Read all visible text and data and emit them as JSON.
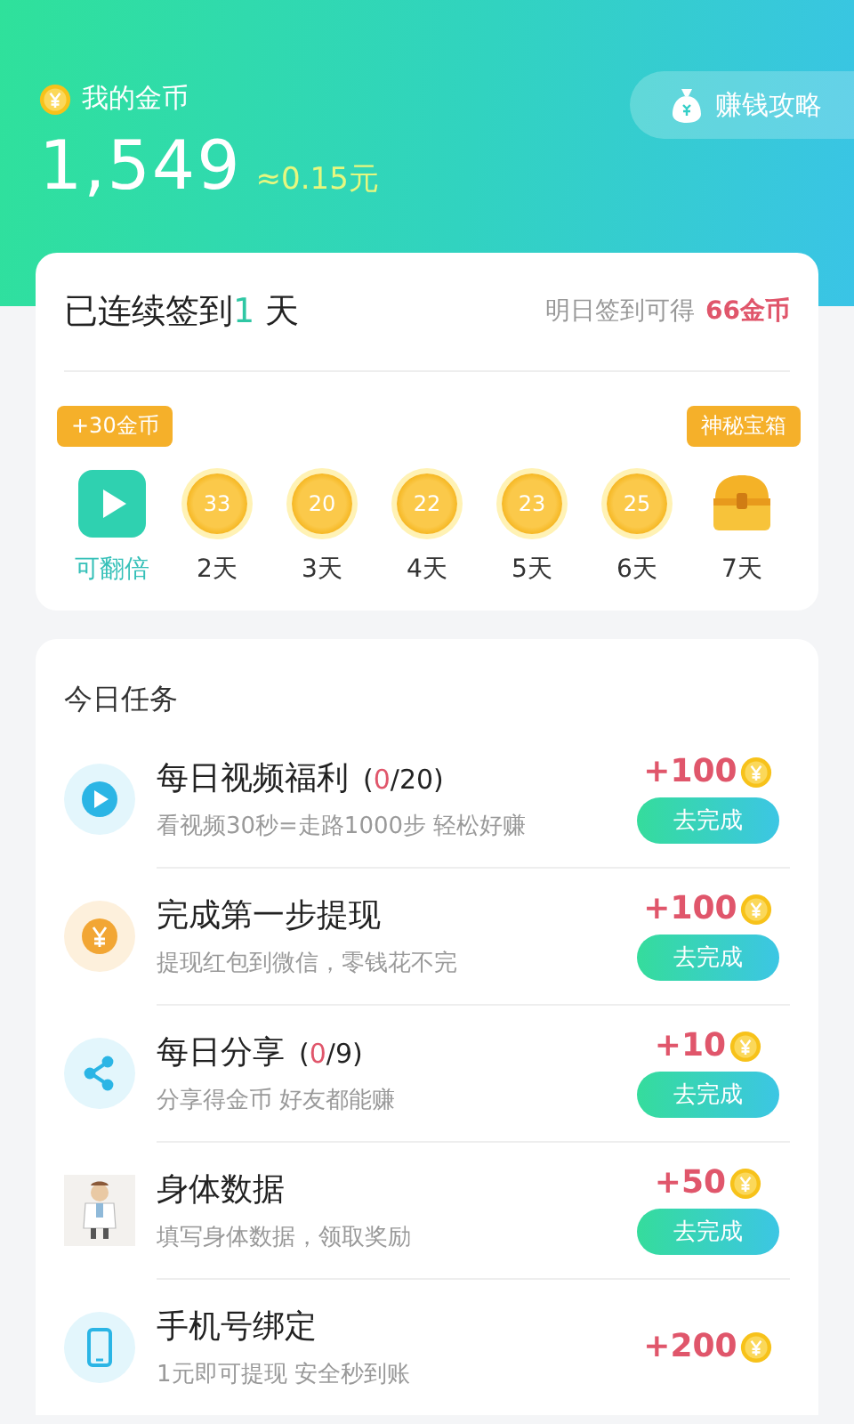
{
  "wallet": {
    "label": "我的金币",
    "balance": "1,549",
    "equivalent": "≈0.15元",
    "guide_button": "赚钱攻略"
  },
  "signin": {
    "streak_prefix": "已连续签到",
    "streak_days": "1",
    "streak_suffix": " 天",
    "tomorrow_label": "明日签到可得",
    "tomorrow_reward": "66金币",
    "days": [
      {
        "kind": "video",
        "label": "可翻倍",
        "tip": "+30金币",
        "highlight": true
      },
      {
        "kind": "coin",
        "amount": "33",
        "label": "2天",
        "highlight": false
      },
      {
        "kind": "coin",
        "amount": "20",
        "label": "3天",
        "highlight": false
      },
      {
        "kind": "coin",
        "amount": "22",
        "label": "4天",
        "highlight": false
      },
      {
        "kind": "coin",
        "amount": "23",
        "label": "5天",
        "highlight": false
      },
      {
        "kind": "coin",
        "amount": "25",
        "label": "6天",
        "highlight": false
      },
      {
        "kind": "chest",
        "label": "7天",
        "tip": "神秘宝箱",
        "highlight": false
      }
    ]
  },
  "tasks": {
    "title": "今日任务",
    "items": [
      {
        "kind": "play",
        "title": "每日视频福利",
        "progress": [
          {
            "kind": "plain",
            "text": "("
          },
          {
            "kind": "done",
            "text": "0"
          },
          {
            "kind": "plain",
            "text": "/20)"
          }
        ],
        "subtitle": "看视频30秒=走路1000步 轻松好赚",
        "reward": "+100",
        "button": "去完成"
      },
      {
        "kind": "yuan",
        "title": "完成第一步提现",
        "subtitle": "提现红包到微信，零钱花不完",
        "reward": "+100",
        "button": "去完成"
      },
      {
        "kind": "share",
        "title": "每日分享",
        "progress": [
          {
            "kind": "plain",
            "text": "("
          },
          {
            "kind": "done",
            "text": "0"
          },
          {
            "kind": "plain",
            "text": "/9)"
          }
        ],
        "subtitle": "分享得金币 好友都能赚",
        "reward": "+10",
        "button": "去完成"
      },
      {
        "kind": "picture",
        "title": "身体数据",
        "subtitle": "填写身体数据，领取奖励",
        "reward": "+50",
        "button": "去完成"
      },
      {
        "kind": "phone",
        "title": "手机号绑定",
        "subtitle": "1元即可提现 安全秒到账",
        "reward": "+200"
      }
    ]
  }
}
